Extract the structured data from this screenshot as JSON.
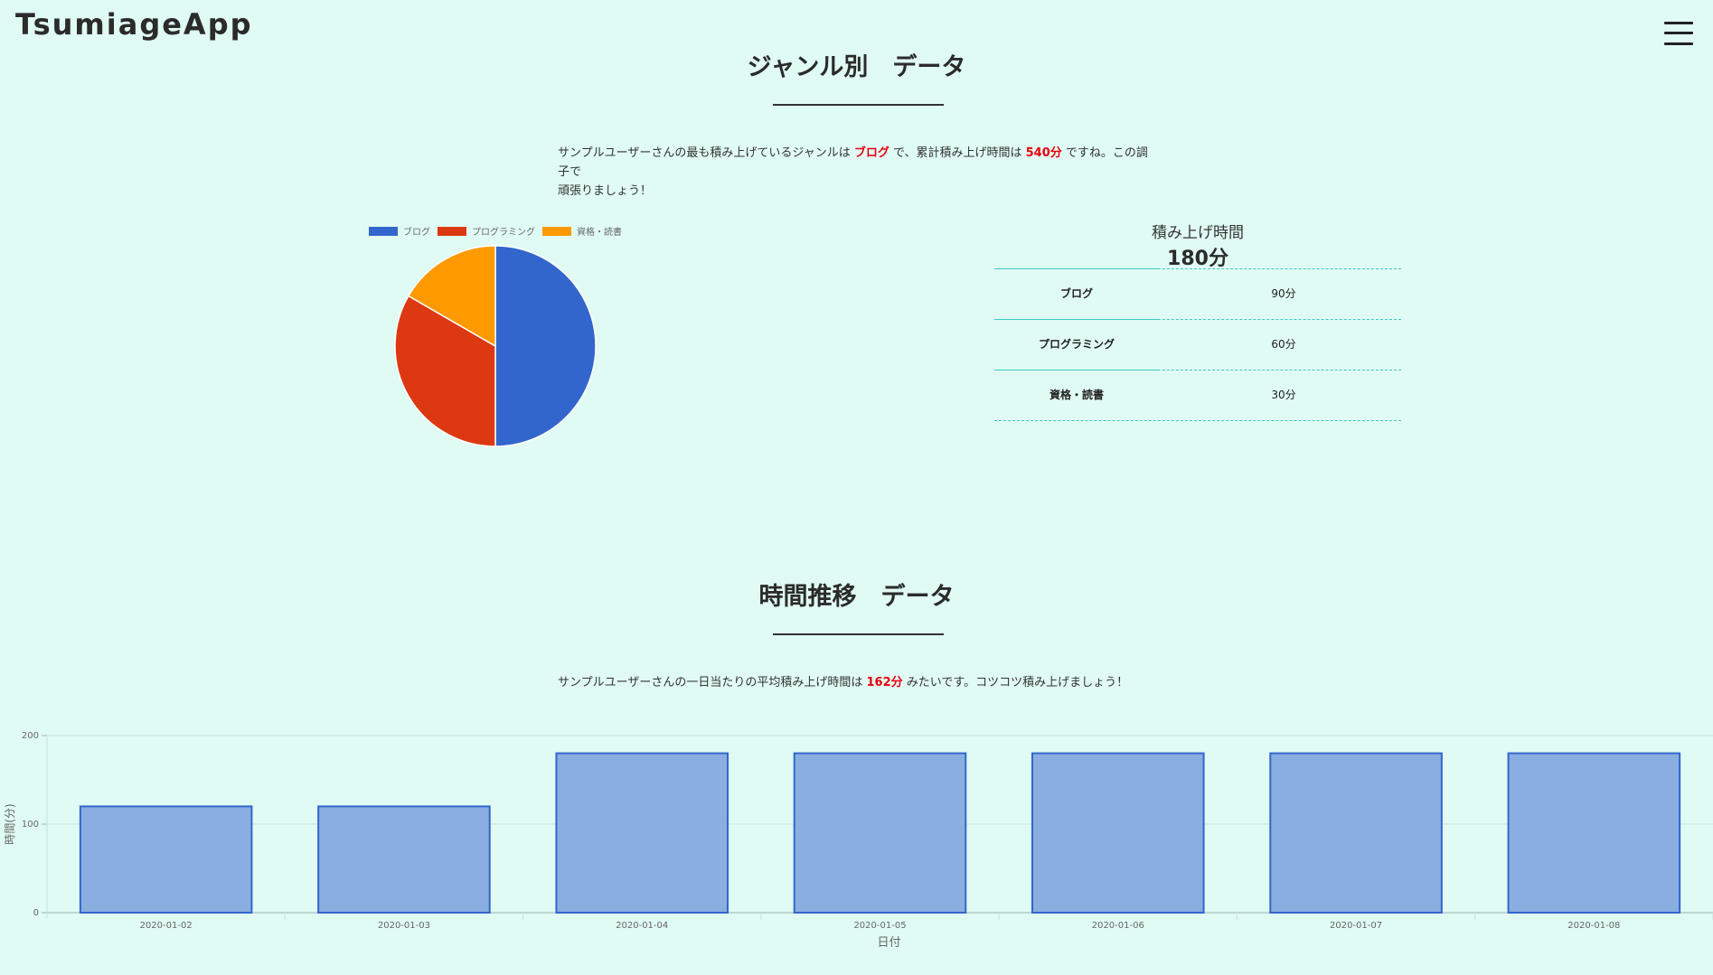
{
  "header": {
    "app_title": "TsumiageApp"
  },
  "genre_section": {
    "title": "ジャンル別　データ",
    "message_prefix": "サンプルユーザーさんの最も積み上げているジャンルは",
    "top_genre": "ブログ",
    "message_middle": "で、累計積み上げ時間は",
    "total_time": "540分",
    "message_suffix_1": "ですね。この調子で",
    "message_suffix_2": "頑張りましょう！"
  },
  "summary_table": {
    "caption": "積み上げ時間",
    "total": "180分",
    "rows": [
      {
        "name": "ブログ",
        "value": "90分"
      },
      {
        "name": "プログラミング",
        "value": "60分"
      },
      {
        "name": "資格・読書",
        "value": "30分"
      }
    ]
  },
  "time_section": {
    "title": "時間推移　データ",
    "message_prefix": "サンプルユーザーさんの一日当たりの平均積み上げ時間は",
    "average": "162分",
    "message_suffix": "みたいです。コツコツ積み上げましょう！"
  },
  "chart_data": [
    {
      "type": "pie",
      "labels": [
        "ブログ",
        "プログラミング",
        "資格・読書"
      ],
      "values": [
        90,
        60,
        30
      ],
      "colors": [
        "#3366cc",
        "#dc3912",
        "#ff9900"
      ],
      "legend_position": "top"
    },
    {
      "type": "bar",
      "categories": [
        "2020-01-02",
        "2020-01-03",
        "2020-01-04",
        "2020-01-05",
        "2020-01-06",
        "2020-01-07",
        "2020-01-08"
      ],
      "values": [
        120,
        120,
        180,
        180,
        180,
        180,
        180
      ],
      "xlabel": "日付",
      "ylabel": "時間(分)",
      "ylim": [
        0,
        200
      ],
      "yticks": [
        0,
        100,
        200
      ],
      "bar_fill": "#8aaee0",
      "bar_stroke": "#3366cc",
      "grid": true
    }
  ]
}
